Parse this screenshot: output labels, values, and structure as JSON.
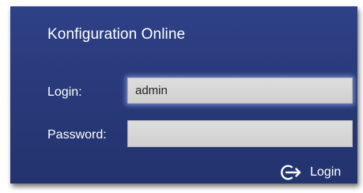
{
  "window": {
    "title": "Konfiguration Online"
  },
  "form": {
    "login_label": "Login:",
    "login_value": "admin",
    "password_label": "Password:",
    "password_value": "",
    "submit_label": "Login",
    "submit_icon": "login-arrow-icon"
  },
  "colors": {
    "panel": "#2a3b7d",
    "field": "#d7d7d7",
    "text": "#ffffff"
  }
}
